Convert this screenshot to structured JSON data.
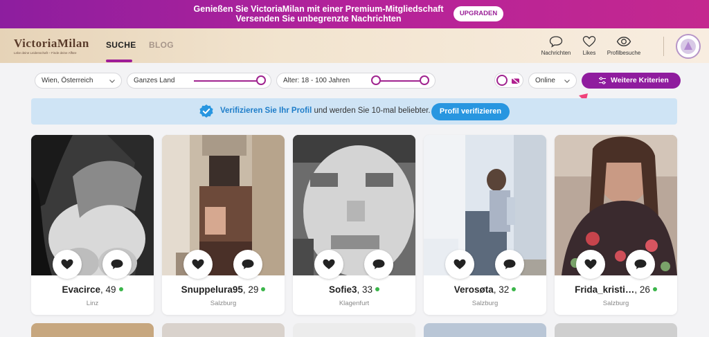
{
  "banner": {
    "line1": "Genießen Sie VictoriaMilan mit einer Premium-Mitgliedschaft",
    "line2": "Versenden Sie unbegrenzte Nachrichten",
    "upgrade_label": "UPGRADEN"
  },
  "header": {
    "logo_text": "VictoriaMilan",
    "logo_tagline": "Lebe deine Leidenschaft – Finde deine Affäre",
    "nav": [
      {
        "label": "SUCHE",
        "active": true
      },
      {
        "label": "BLOG",
        "active": false
      }
    ],
    "icons": [
      {
        "icon": "speech-bubble-icon",
        "label": "Nachrichten"
      },
      {
        "icon": "heart-icon",
        "label": "Likes"
      },
      {
        "icon": "eye-icon",
        "label": "Profilbesuche"
      }
    ]
  },
  "filters": {
    "location": "Wien, Österreich",
    "distance": "Ganzes Land",
    "age": "Alter: 18 - 100 Jahren",
    "status": "Online",
    "more_label": "Weitere Kriterien"
  },
  "verify": {
    "bold_text": "Verifizieren Sie Ihr Profil",
    "rest_text": "und werden Sie 10-mal beliebter.",
    "button_label": "Profil verifizieren"
  },
  "profiles": [
    {
      "name": "Evacirce",
      "age": ", 49",
      "city": "Linz",
      "online": true
    },
    {
      "name": "Snuppelura95",
      "age": ", 29",
      "city": "Salzburg",
      "online": true
    },
    {
      "name": "Sofie3",
      "age": ", 33",
      "city": "Klagenfurt",
      "online": true
    },
    {
      "name": "Verosøta",
      "age": ", 32",
      "city": "Salzburg",
      "online": true
    },
    {
      "name": "Frida_kristi…",
      "age": ", 26",
      "city": "Salzburg",
      "online": true
    }
  ],
  "colors": {
    "brand_purple": "#8f1c9e",
    "verify_blue": "#2896e0",
    "online_green": "#3bb54a"
  }
}
